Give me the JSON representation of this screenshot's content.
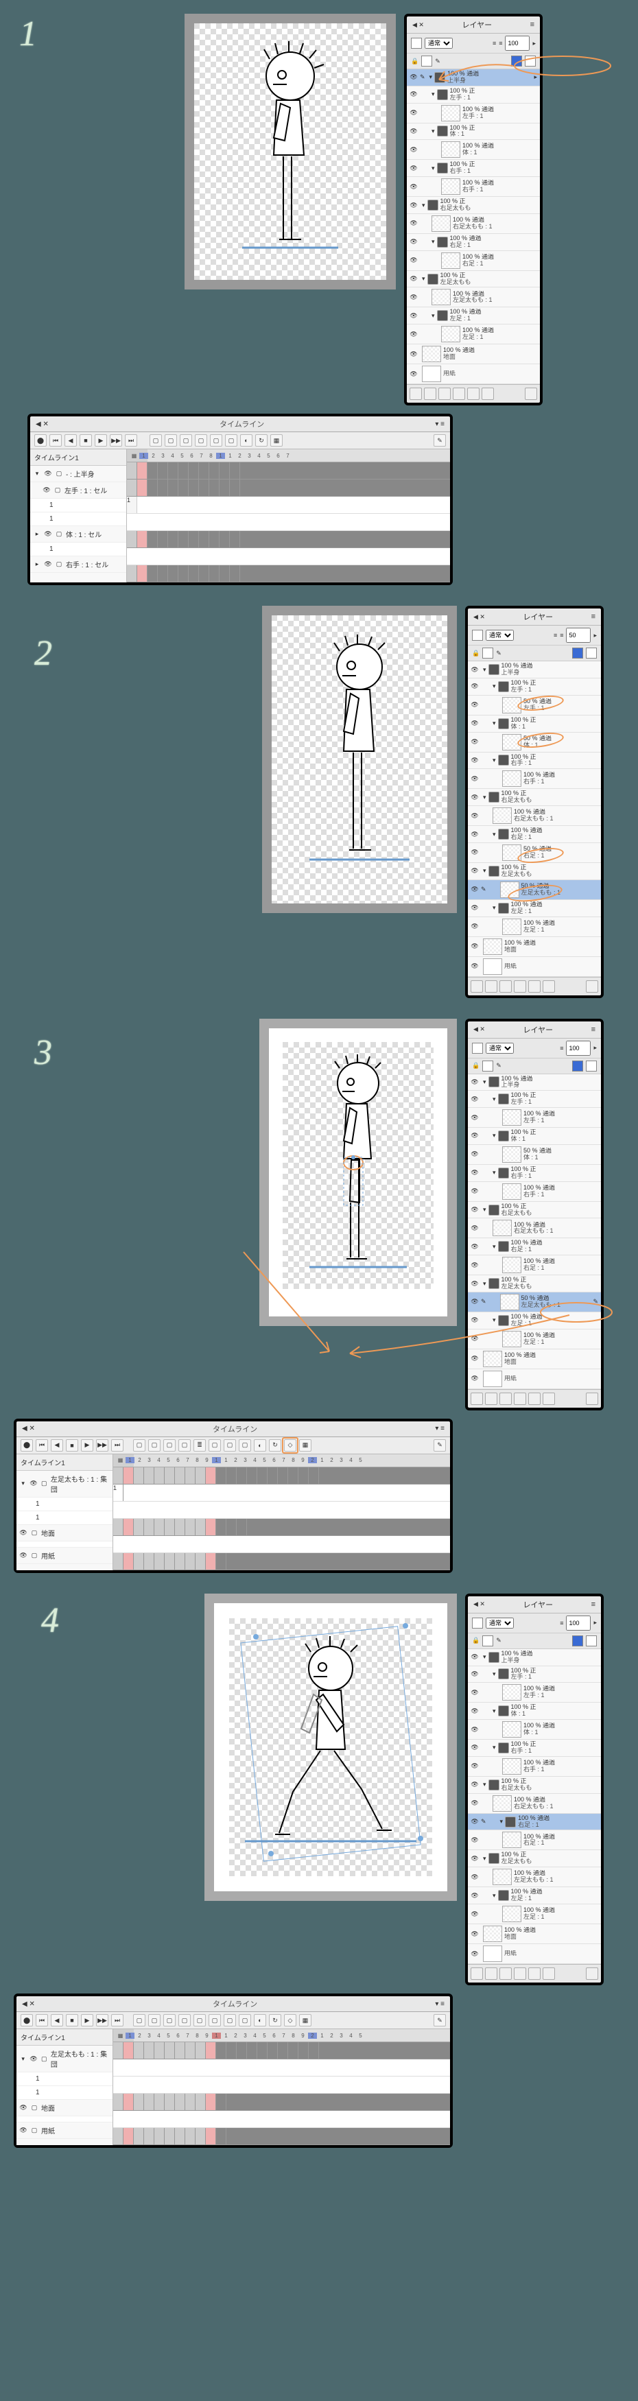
{
  "steps": [
    "1",
    "2",
    "3",
    "4"
  ],
  "layers_title": "レイヤー",
  "timeline_title": "タイムライン",
  "blend_mode": "通常",
  "opacity_val": "100",
  "opacity_50": "50",
  "timeline1_name": "タイムライン1",
  "opacity_label_100": "100 % 通過",
  "opacity_label_50": "50 % 通過",
  "layer_upper_body": "上半身",
  "layer_left_hand": "左手 : 1",
  "layer_left_hand_alt": "左手 : 1",
  "layer_right_hand": "右手 : 1",
  "layer_body": "体 : 1",
  "layer_right_thigh": "右足太もも",
  "layer_right_thigh_c": "右足太もも : 1",
  "layer_right_leg": "右足 : 1",
  "layer_left_thigh": "左足太もも",
  "layer_left_thigh_c": "左足太もも : 1",
  "layer_left_leg": "左足 : 1",
  "layer_ground": "地面",
  "layer_paper": "用紙",
  "layer_100_right": "100 % 正",
  "tree_upper": "- : 上半身",
  "tree_lefthand": "左手 : 1 : セル",
  "tree_body": "体 : 1 : セル",
  "tree_righthand": "右手 : 1 : セル",
  "tree_leftthigh": "左足太もも : 1 : 集団",
  "tree_ground": "地面",
  "tree_paper": "用紙",
  "cell_1": "1",
  "ruler": [
    "1",
    "2",
    "3",
    "4",
    "5",
    "6",
    "7",
    "8",
    "9",
    "1",
    "1",
    "2",
    "3",
    "4",
    "5",
    "6",
    "7",
    "8",
    "9",
    "2"
  ]
}
